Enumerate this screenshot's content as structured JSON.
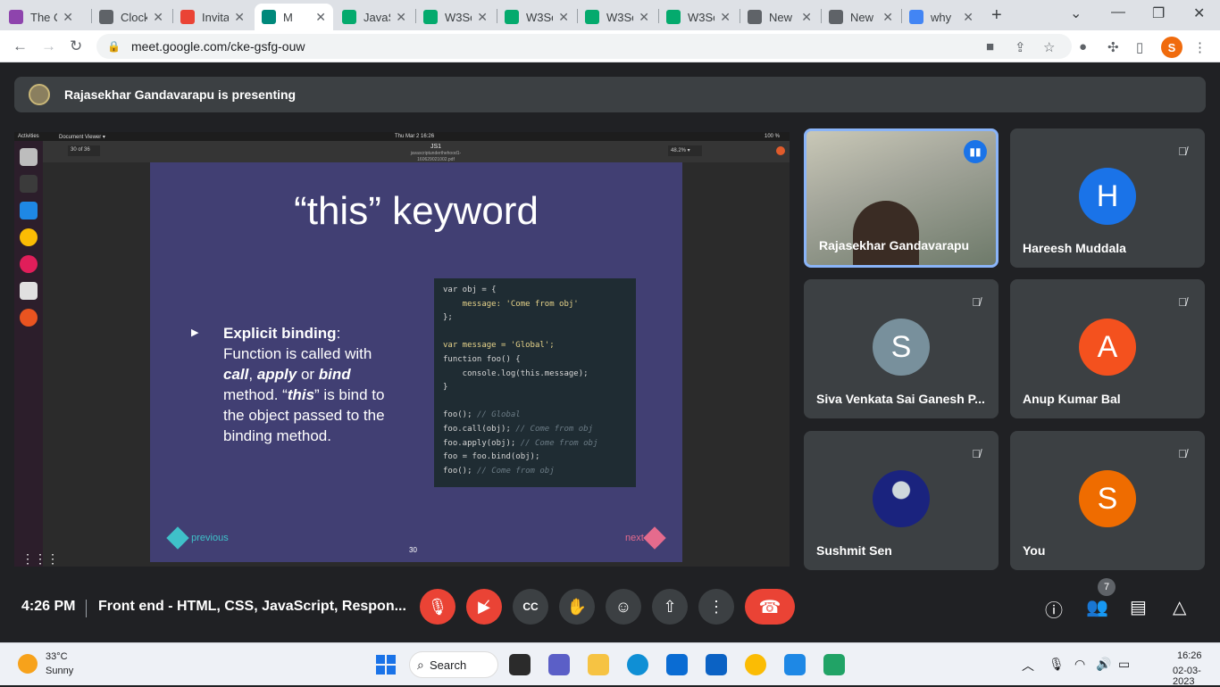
{
  "browser": {
    "tabs": [
      {
        "title": "The C",
        "favicon": "purple-circle-icon",
        "color": "#8e44ad"
      },
      {
        "title": "Clock",
        "favicon": "clockify-icon",
        "color": "#5f6368"
      },
      {
        "title": "Invita",
        "favicon": "gmail-icon",
        "color": "#ea4335"
      },
      {
        "title": "M",
        "favicon": "meet-icon",
        "color": "#00897b",
        "active": true
      },
      {
        "title": "JavaS",
        "favicon": "w3schools-icon",
        "color": "#04aa6d"
      },
      {
        "title": "W3Sc",
        "favicon": "w3schools-icon",
        "color": "#04aa6d"
      },
      {
        "title": "W3Sc",
        "favicon": "w3schools-icon",
        "color": "#04aa6d"
      },
      {
        "title": "W3Sc",
        "favicon": "w3schools-icon",
        "color": "#04aa6d"
      },
      {
        "title": "W3Sc",
        "favicon": "w3schools-icon",
        "color": "#04aa6d"
      },
      {
        "title": "New",
        "favicon": "globe-icon",
        "color": "#5f6368"
      },
      {
        "title": "New",
        "favicon": "globe-icon",
        "color": "#5f6368"
      },
      {
        "title": "why",
        "favicon": "google-icon",
        "color": "#4285f4"
      }
    ],
    "url": "meet.google.com/cke-gsfg-ouw",
    "profile_initial": "S"
  },
  "meet": {
    "presenting_banner": "Rajasekhar Gandavarapu is presenting",
    "shared_screen": {
      "activities": "Activities",
      "app_menu": "Document Viewer ▾",
      "clock": "Thu Mar 2  16:26",
      "battery": "100 %",
      "doc_title": "JS1",
      "doc_file": "javascriptunderthehood1-160629021002.pdf",
      "page_current": "30",
      "page_total": "of 36",
      "zoom": "48.2% ▾",
      "slide": {
        "title": "“this” keyword",
        "bullet_lead": "Explicit binding",
        "bullet_colon": ":",
        "line1": "Function is called with",
        "kw_call": "call",
        "comma": ", ",
        "kw_apply": "apply",
        "or": " or ",
        "kw_bind": "bind",
        "line3a": "method. “",
        "kw_this": "this",
        "line3b": "” is bind to",
        "line4": "the object passed to the",
        "line5": "binding method.",
        "code": [
          "var obj = {",
          "    message: 'Come from obj'",
          "};",
          "",
          "var message = 'Global';",
          "function foo() {",
          "    console.log(this.message);",
          "}",
          "",
          "foo(); // Global",
          "foo.call(obj); // Come from obj",
          "foo.apply(obj); // Come from obj",
          "foo = foo.bind(obj);",
          "foo(); // Come from obj"
        ],
        "prev_label": "previous",
        "next_label": "next",
        "page_number": "30"
      }
    },
    "participants": [
      {
        "name": "Rajasekhar Gandavarapu",
        "type": "camera",
        "speaking": true
      },
      {
        "name": "Hareesh Muddala",
        "initial": "H",
        "color": "#1a73e8",
        "muted": true
      },
      {
        "name": "Siva Venkata Sai Ganesh P...",
        "initial": "S",
        "color": "#78909c",
        "muted": true
      },
      {
        "name": "Anup Kumar Bal",
        "initial": "A",
        "color": "#f4511e",
        "muted": true
      },
      {
        "name": "Sushmit Sen",
        "type": "photo",
        "muted": true
      },
      {
        "name": "You",
        "initial": "S",
        "color": "#ef6c00",
        "muted": true
      }
    ],
    "bottom": {
      "time": "4:26 PM",
      "meeting_title": "Front end - HTML, CSS, JavaScript, Respon...",
      "people_count": "7"
    }
  },
  "taskbar": {
    "temperature": "33°C",
    "condition": "Sunny",
    "search_label": "Search",
    "time": "16:26",
    "date": "02-03-2023"
  }
}
